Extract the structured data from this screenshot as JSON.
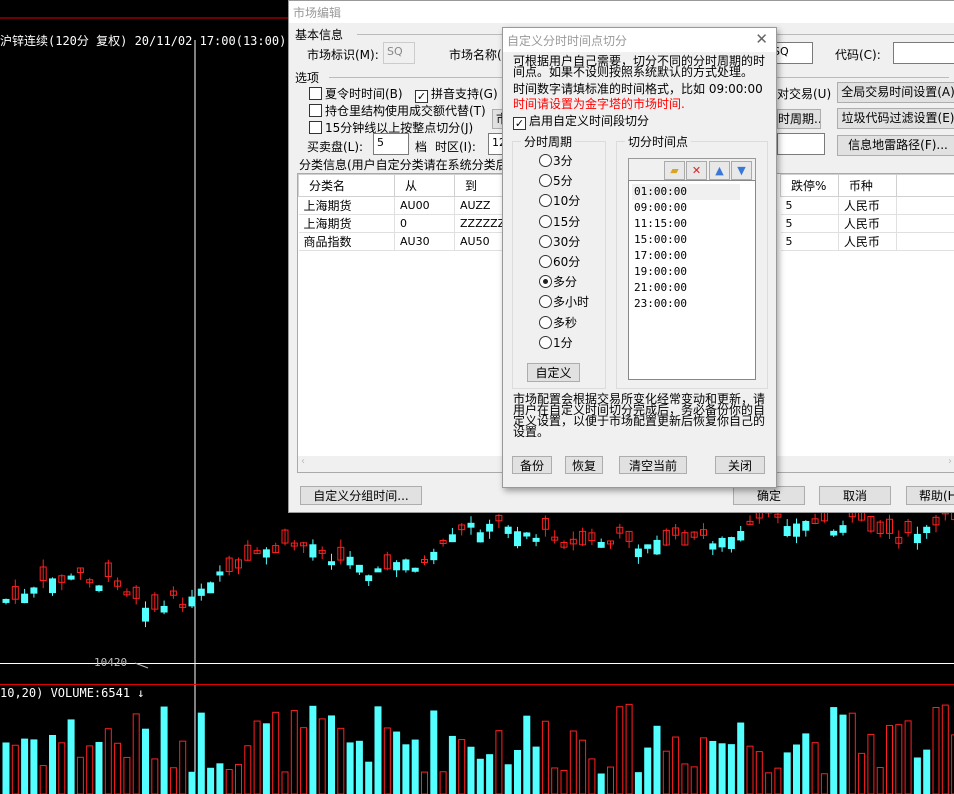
{
  "chart": {
    "title": "沪锌连续(120分 复权) 20/11/02 17:00(13:00)",
    "price_marker": "10420",
    "volume_label": "10,20) VOLUME:6541",
    "volume_arrow": "↓",
    "colors": {
      "up": "#ff2020",
      "down": "#54ffff",
      "background": "#000000"
    }
  },
  "market_dialog": {
    "title": "市场编辑",
    "basic_info": "基本信息",
    "market_id_label": "市场标识(M):",
    "market_id_value": "SQ",
    "market_name_label": "市场名称(",
    "market_name_value": "SQ",
    "code_label": "代码(C):",
    "code_value": "",
    "options": "选项",
    "dst": {
      "label": "夏令时时间(B)",
      "checked": false
    },
    "pinyin": {
      "label": "拼音支持(G)",
      "checked": true
    },
    "oi_struct": {
      "label": "持仓里结构使用成交额代替(T)",
      "checked": false
    },
    "split15": {
      "label": "15分钟线以上按整点切分(J)",
      "checked": false
    },
    "trade_partial": "对交易(U)",
    "period_partial": "时周期..",
    "bidask_label": "买卖盘(L):",
    "bidask_value": "5",
    "level_label": "档",
    "timezone_label": "时区(I):",
    "timezone_value": "12",
    "global_time_btn": "全局交易时间设置(A)",
    "junk_filter_btn": "垃圾代码过滤设置(E)",
    "info_path_btn": "信息地雷路径(F)...",
    "category_info": "分类信息(用户自定分类请在系统分类后",
    "columns": [
      "分类名",
      "从",
      "到"
    ],
    "columns_right": [
      "跌停%",
      "币种"
    ],
    "rows": [
      {
        "name": "上海期货",
        "from": "AU00",
        "to": "AUZZ",
        "limit": "5",
        "currency": "人民币"
      },
      {
        "name": "上海期货",
        "from": "0",
        "to": "ZZZZZZZZ",
        "limit": "5",
        "currency": "人民币"
      },
      {
        "name": "商品指数",
        "from": "AU30",
        "to": "AU50",
        "limit": "5",
        "currency": "人民币"
      }
    ],
    "custom_group_btn": "自定义分组时间...",
    "ok_btn": "确定",
    "cancel_btn": "取消",
    "help_btn": "帮助(H)"
  },
  "split_dialog": {
    "title": "自定义分时时间点切分",
    "close": "✕",
    "desc1": "可根据用户自己需要，切分不同的分时周期的时间点。如果不设则按照系统默认的方式处理。",
    "desc2": "时间数字请填标准的时间格式，比如 09:00:00",
    "warning": "时间请设置为金字塔的市场时间.",
    "enable": {
      "label": "启用自定义时间段切分",
      "checked": true
    },
    "period_group": "分时周期",
    "periods": [
      "3分",
      "5分",
      "10分",
      "15分",
      "30分",
      "60分",
      "多分",
      "多小时",
      "多秒",
      "1分"
    ],
    "selected_period": "多分",
    "custom_btn": "自定义",
    "points_group": "切分时间点",
    "points": [
      "01:00:00",
      "09:00:00",
      "11:15:00",
      "15:00:00",
      "17:00:00",
      "19:00:00",
      "21:00:00",
      "23:00:00"
    ],
    "note": "市场配置会根据交易所变化经常变动和更新，请用户在自定义时间切分完成后，务必备份你的自定义设置，以便于市场配置更新后恢复你自己的设置。",
    "backup_btn": "备份",
    "restore_btn": "恢复",
    "clear_btn": "清空当前",
    "close_btn": "关闭"
  }
}
